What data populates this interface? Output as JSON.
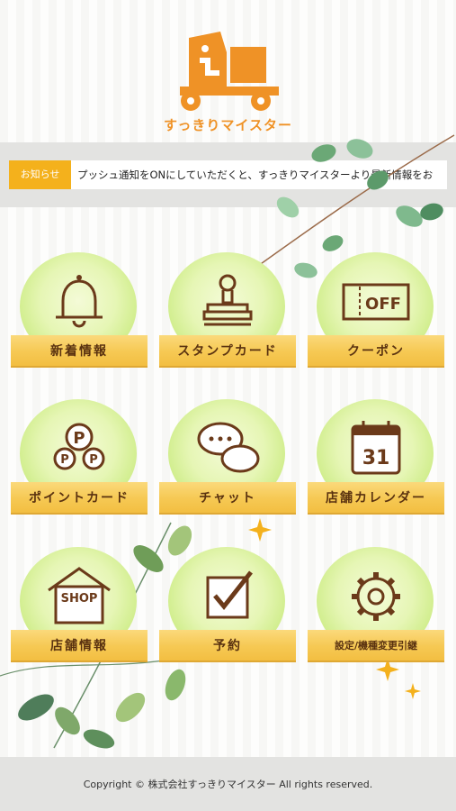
{
  "header": {
    "logo_text": "すっきりマイスター"
  },
  "notice": {
    "label": "お知らせ",
    "text": "プッシュ通知をONにしていただくと、すっきりマイスターより最新情報をお"
  },
  "menu": {
    "news": "新着情報",
    "stamp_card": "スタンプカード",
    "coupon": "クーポン",
    "point_card": "ポイントカード",
    "chat": "チャット",
    "calendar": "店舗カレンダー",
    "shop_info": "店舗情報",
    "reservation": "予約",
    "settings": "設定/機種変更引継"
  },
  "icons": {
    "coupon_text": "OFF",
    "point_letter": "P",
    "calendar_day": "31",
    "shop_text": "SHOP"
  },
  "footer": {
    "copyright": "Copyright © 株式会社すっきりマイスター All rights reserved."
  },
  "colors": {
    "brand_orange": "#ef9226",
    "notice_yellow": "#f4b11c",
    "plank": "#f6c954",
    "icon_brown": "#6b3a1a"
  }
}
